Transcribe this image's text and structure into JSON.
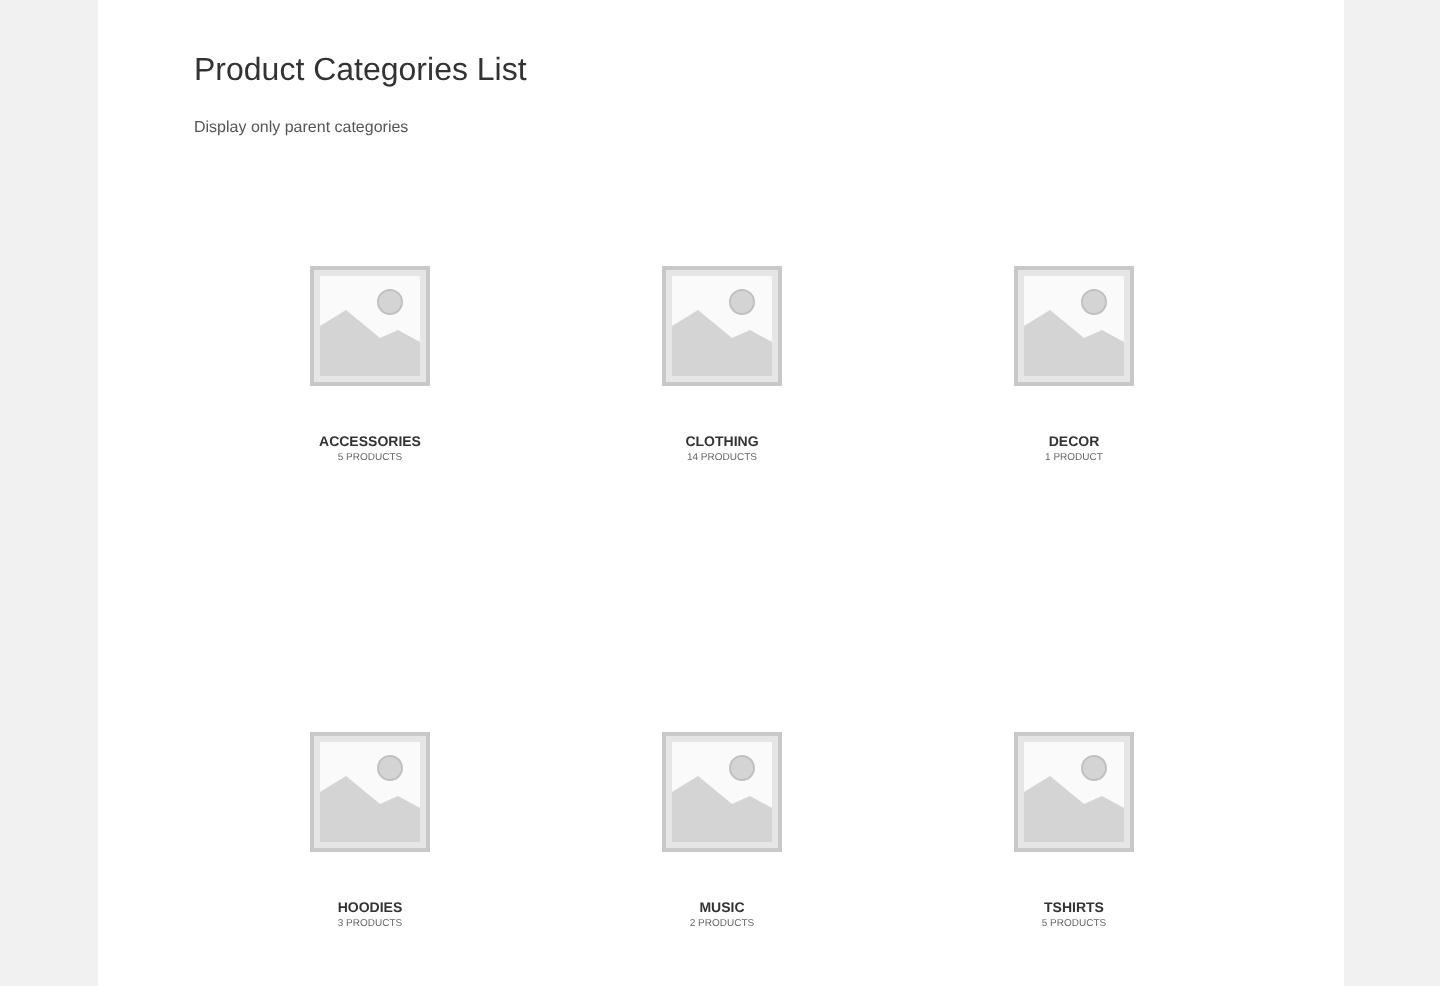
{
  "title": "Product Categories List",
  "subtitle": "Display only parent categories",
  "categories": [
    {
      "name": "ACCESSORIES",
      "count": "5 PRODUCTS"
    },
    {
      "name": "CLOTHING",
      "count": "14 PRODUCTS"
    },
    {
      "name": "DECOR",
      "count": "1 PRODUCT"
    },
    {
      "name": "HOODIES",
      "count": "3 PRODUCTS"
    },
    {
      "name": "MUSIC",
      "count": "2 PRODUCTS"
    },
    {
      "name": "TSHIRTS",
      "count": "5 PRODUCTS"
    }
  ]
}
